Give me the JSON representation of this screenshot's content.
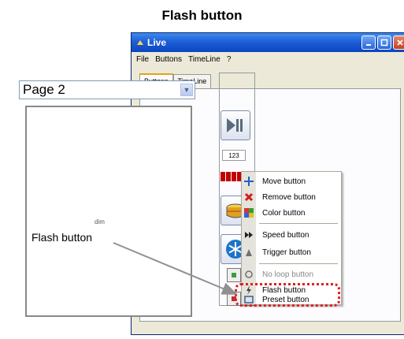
{
  "heading": "Flash button",
  "left_label": "Flash button",
  "window": {
    "title": "Live",
    "menu": [
      "File",
      "Buttons",
      "TimeLine",
      "?"
    ],
    "tabs": [
      "Buttons",
      "TimeLine"
    ]
  },
  "page_selector": {
    "value": "Page 2"
  },
  "canvas_label": "dim",
  "side_panel": {
    "counter": "123"
  },
  "context_menu": {
    "items": [
      {
        "label": "Move button",
        "icon": "move-icon"
      },
      {
        "label": "Remove button",
        "icon": "remove-icon"
      },
      {
        "label": "Color button",
        "icon": "color-icon"
      },
      {
        "label": "Speed button",
        "icon": "speed-icon"
      },
      {
        "label": "Trigger button",
        "icon": "trigger-icon"
      },
      {
        "label": "No loop button",
        "icon": "no-loop-icon"
      },
      {
        "label": "Flash button",
        "icon": "flash-icon"
      },
      {
        "label": "Preset button",
        "icon": "preset-icon"
      }
    ]
  },
  "colors": {
    "titlebar": "#1E5ED6",
    "window_bg": "#ECE9D8",
    "highlight": "#E02020",
    "arrow": "#909090"
  }
}
